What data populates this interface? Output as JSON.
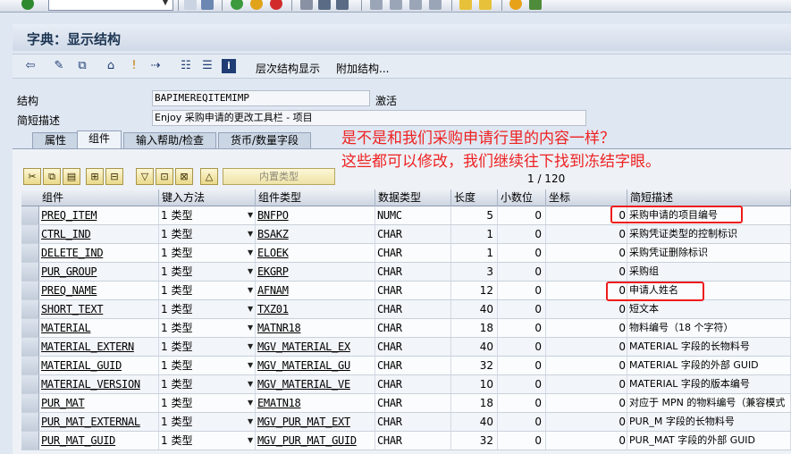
{
  "window": {
    "title": "字典：显示结构"
  },
  "app_toolbar": {
    "hierarchy_label": "层次结构显示",
    "append_label": "附加结构..."
  },
  "header": {
    "structure_label": "结构",
    "structure_value": "BAPIMEREQITEMIMP",
    "status": "激活",
    "desc_label": "简短描述",
    "desc_value": "Enjoy 采购申请的更改工具栏 - 项目"
  },
  "tabs": [
    {
      "label": "属性"
    },
    {
      "label": "组件"
    },
    {
      "label": "输入帮助/检查"
    },
    {
      "label": "货币/数量字段"
    }
  ],
  "table_toolbar": {
    "builtin_type_label": "内置类型"
  },
  "pager": {
    "text": "1 / 120"
  },
  "annotation": {
    "line1": "是不是和我们采购申请行里的内容一样？",
    "line2": "这些都可以修改，我们继续往下找到冻结字眼。",
    "color": "#ee2222"
  },
  "columns": [
    "组件",
    "键入方法",
    "组件类型",
    "数据类型",
    "长度",
    "小数位",
    "坐标",
    "简短描述"
  ],
  "rows": [
    {
      "component": "PREQ_ITEM",
      "method": "1 类型",
      "type": "BNFPO",
      "dtype": "NUMC",
      "length": "5",
      "decimals": "0",
      "coord": "0",
      "desc": "采购申请的项目编号"
    },
    {
      "component": "CTRL_IND",
      "method": "1 类型",
      "type": "BSAKZ",
      "dtype": "CHAR",
      "length": "1",
      "decimals": "0",
      "coord": "0",
      "desc": "采购凭证类型的控制标识"
    },
    {
      "component": "DELETE_IND",
      "method": "1 类型",
      "type": "ELOEK",
      "dtype": "CHAR",
      "length": "1",
      "decimals": "0",
      "coord": "0",
      "desc": "采购凭证删除标识"
    },
    {
      "component": "PUR_GROUP",
      "method": "1 类型",
      "type": "EKGRP",
      "dtype": "CHAR",
      "length": "3",
      "decimals": "0",
      "coord": "0",
      "desc": "采购组"
    },
    {
      "component": "PREQ_NAME",
      "method": "1 类型",
      "type": "AFNAM",
      "dtype": "CHAR",
      "length": "12",
      "decimals": "0",
      "coord": "0",
      "desc": "申请人姓名"
    },
    {
      "component": "SHORT_TEXT",
      "method": "1 类型",
      "type": "TXZ01",
      "dtype": "CHAR",
      "length": "40",
      "decimals": "0",
      "coord": "0",
      "desc": "短文本"
    },
    {
      "component": "MATERIAL",
      "method": "1 类型",
      "type": "MATNR18",
      "dtype": "CHAR",
      "length": "18",
      "decimals": "0",
      "coord": "0",
      "desc": "物料编号（18 个字符）"
    },
    {
      "component": "MATERIAL_EXTERN",
      "method": "1 类型",
      "type": "MGV_MATERIAL_EX",
      "dtype": "CHAR",
      "length": "40",
      "decimals": "0",
      "coord": "0",
      "desc": "MATERIAL 字段的长物料号"
    },
    {
      "component": "MATERIAL_GUID",
      "method": "1 类型",
      "type": "MGV_MATERIAL_GU",
      "dtype": "CHAR",
      "length": "32",
      "decimals": "0",
      "coord": "0",
      "desc": "MATERIAL 字段的外部 GUID"
    },
    {
      "component": "MATERIAL_VERSION",
      "method": "1 类型",
      "type": "MGV_MATERIAL_VE",
      "dtype": "CHAR",
      "length": "10",
      "decimals": "0",
      "coord": "0",
      "desc": "MATERIAL 字段的版本编号"
    },
    {
      "component": "PUR_MAT",
      "method": "1 类型",
      "type": "EMATN18",
      "dtype": "CHAR",
      "length": "18",
      "decimals": "0",
      "coord": "0",
      "desc": "对应于 MPN 的物料编号（兼容模式"
    },
    {
      "component": "PUR_MAT_EXTERNAL",
      "method": "1 类型",
      "type": "MGV_PUR_MAT_EXT",
      "dtype": "CHAR",
      "length": "40",
      "decimals": "0",
      "coord": "0",
      "desc": "PUR_M 字段的长物料号"
    },
    {
      "component": "PUR_MAT_GUID",
      "method": "1 类型",
      "type": "MGV_PUR_MAT_GUID",
      "dtype": "CHAR",
      "length": "32",
      "decimals": "0",
      "coord": "0",
      "desc": "PUR_MAT 字段的外部 GUID"
    }
  ]
}
